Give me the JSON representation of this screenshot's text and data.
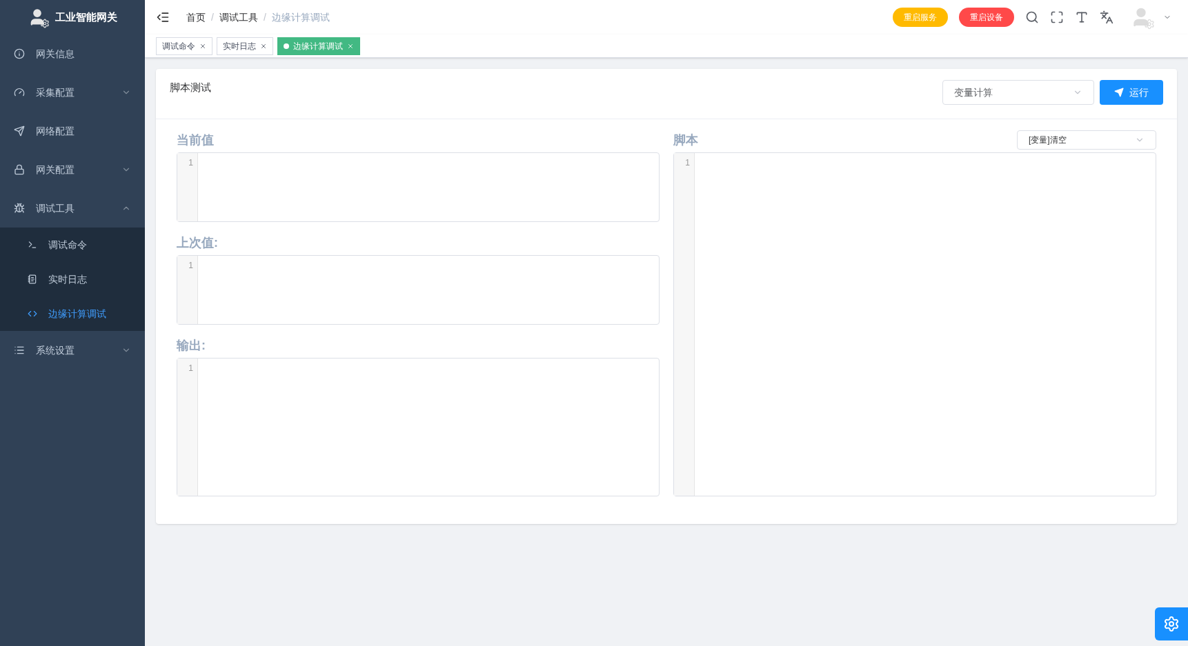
{
  "sidebar": {
    "title": "工业智能网关",
    "items": [
      {
        "kind": "link",
        "label": "网关信息"
      },
      {
        "kind": "group",
        "label": "采集配置",
        "expanded": false
      },
      {
        "kind": "link",
        "label": "网络配置"
      },
      {
        "kind": "group",
        "label": "网关配置",
        "expanded": false
      },
      {
        "kind": "group",
        "label": "调试工具",
        "expanded": true,
        "children": [
          {
            "label": "调试命令",
            "selected": false
          },
          {
            "label": "实时日志",
            "selected": false
          },
          {
            "label": "边缘计算调试",
            "selected": true
          }
        ]
      },
      {
        "kind": "group",
        "label": "系统设置",
        "expanded": false
      }
    ]
  },
  "breadcrumb": [
    "首页",
    "调试工具",
    "边缘计算调试"
  ],
  "breadcrumb_separator": "/",
  "header_buttons": [
    {
      "label": "重启服务",
      "color": "#ffba00"
    },
    {
      "label": "重启设备",
      "color": "#ff4949"
    }
  ],
  "tabs": [
    {
      "label": "调试命令",
      "selected": false
    },
    {
      "label": "实时日志",
      "selected": false
    },
    {
      "label": "边缘计算调试",
      "selected": true
    }
  ],
  "card": {
    "title": "脚本测试",
    "mode_select": "变量计算",
    "run_button": "运行",
    "left_editors": [
      {
        "label": "当前值",
        "line": "1"
      },
      {
        "label": "上次值:",
        "line": "1"
      },
      {
        "label": "输出:",
        "line": "1"
      }
    ],
    "script_editor": {
      "label": "脚本",
      "template_select": "[变量]清空",
      "line": "1"
    }
  }
}
